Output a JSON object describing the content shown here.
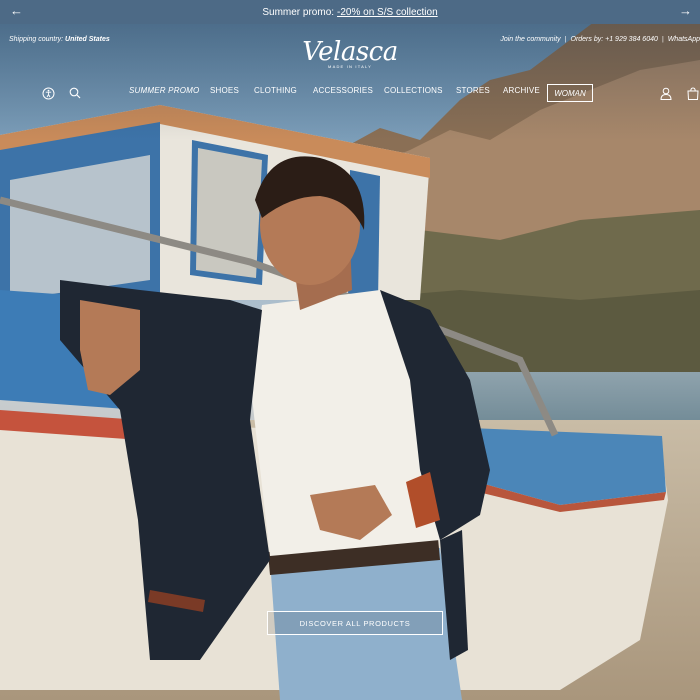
{
  "promo_bar": {
    "text": "Summer promo:",
    "link": "-20% on S/S collection",
    "prev_icon": "arrow-left-icon",
    "next_icon": "arrow-right-icon",
    "background": "#4d6a86"
  },
  "header": {
    "shipping_label": "Shipping country:",
    "shipping_country": "United States",
    "utility_links": [
      "Join the community",
      "Orders by: +1 929 384 6040",
      "WhatsApp"
    ],
    "logo_word": "Velasca",
    "logo_tagline": "MADE IN ITALY"
  },
  "nav": {
    "items": [
      "SUMMER PROMO",
      "SHOES",
      "CLOTHING",
      "ACCESSORIES",
      "COLLECTIONS",
      "STORES",
      "ARCHIVE"
    ],
    "woman_button": "WOMAN",
    "left_icons": [
      "accessibility-icon",
      "search-icon"
    ],
    "right_icons": [
      "account-icon",
      "cart-icon"
    ]
  },
  "hero": {
    "cta_label": "DISCOVER ALL PRODUCTS"
  }
}
